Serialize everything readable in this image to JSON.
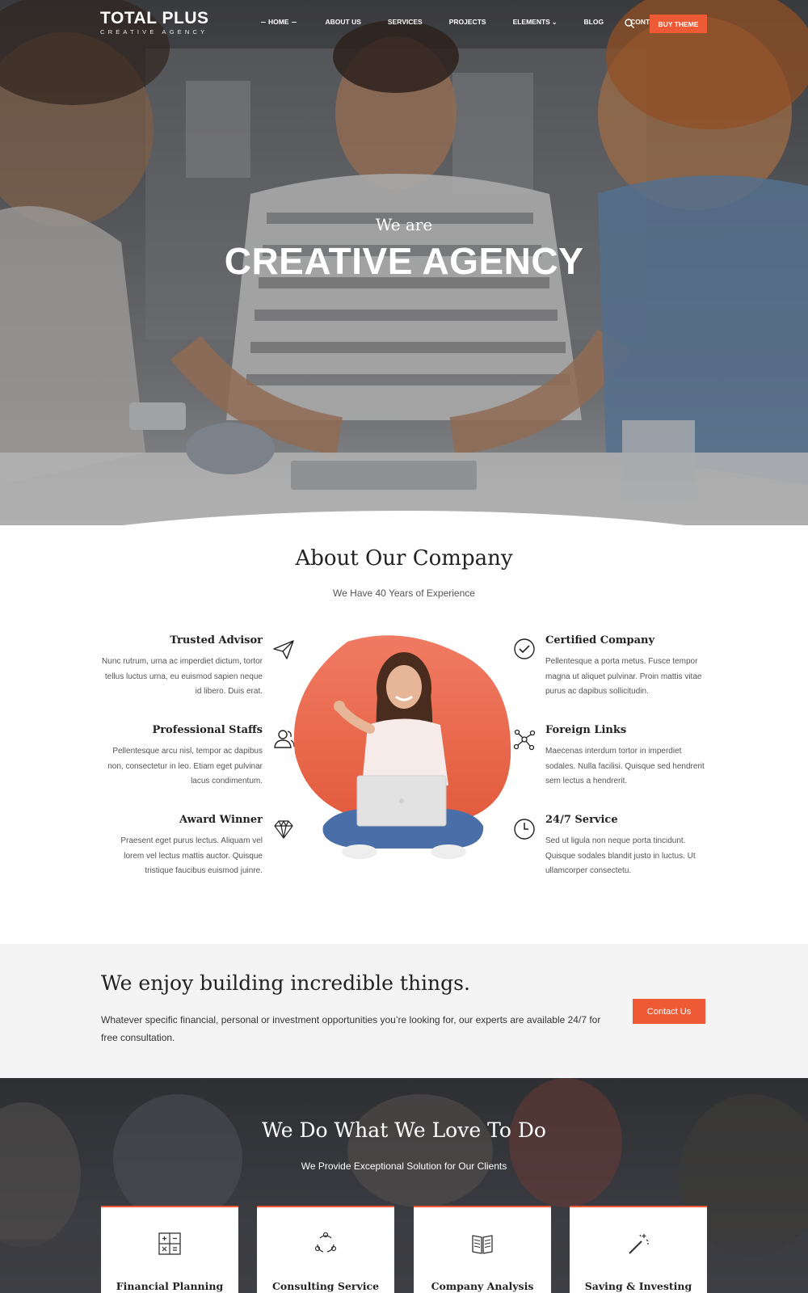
{
  "brand": {
    "name": "TOTAL PLUS",
    "tagline": "CREATIVE AGENCY"
  },
  "nav": {
    "items": [
      {
        "label": "HOME"
      },
      {
        "label": "ABOUT US"
      },
      {
        "label": "SERVICES"
      },
      {
        "label": "PROJECTS"
      },
      {
        "label": "ELEMENTS"
      },
      {
        "label": "BLOG"
      },
      {
        "label": "CONTACT US"
      }
    ],
    "cta_label": "BUY THEME"
  },
  "hero": {
    "pre_title": "We are",
    "title": "CREATIVE AGENCY"
  },
  "about": {
    "title": "About Our Company",
    "subtitle": "We Have 40 Years of Experience",
    "features": [
      {
        "title": "Trusted Advisor",
        "text": "Nunc rutrum, urna ac imperdiet dictum, tortor tellus luctus urna, eu euismod sapien neque id libero. Duis erat.",
        "icon": "paper-plane-icon"
      },
      {
        "title": "Professional Staffs",
        "text": "Pellentesque arcu nisl, tempor ac dapibus non, consectetur in leo. Etiam eget pulvinar lacus condimentum.",
        "icon": "users-icon"
      },
      {
        "title": "Award Winner",
        "text": "Praesent eget purus lectus. Aliquam vel lorem vel lectus mattis auctor. Quisque tristique faucibus euismod juinre.",
        "icon": "diamond-icon"
      },
      {
        "title": "Certified Company",
        "text": "Pellentesque a porta metus. Fusce tempor magna ut aliquet pulvinar. Proin mattis vitae purus ac dapibus sollicitudin.",
        "icon": "check-circle-icon"
      },
      {
        "title": "Foreign Links",
        "text": "Maecenas interdum tortor in imperdiet sodales. Nulla facilisi. Quisque sed hendrerit sem lectus a hendrerit.",
        "icon": "network-icon"
      },
      {
        "title": "24/7 Service",
        "text": "Sed ut ligula non neque porta tincidunt. Quisque sodales blandit justo in luctus. Ut ullamcorper consectetu.",
        "icon": "clock-icon"
      }
    ]
  },
  "cta": {
    "title": "We enjoy building incredible things.",
    "text": "Whatever specific financial, personal or investment opportunities you’re looking for, our experts are available 24/7 for free consultation.",
    "button_label": "Contact Us"
  },
  "services": {
    "title": "We Do What We Love To Do",
    "subtitle": "We Provide Exceptional Solution for Our Clients",
    "cards": [
      {
        "label": "Financial Planning",
        "icon": "calculator-icon"
      },
      {
        "label": "Consulting Service",
        "icon": "cycle-icon"
      },
      {
        "label": "Company Analysis",
        "icon": "book-icon"
      },
      {
        "label": "Saving & Investing",
        "icon": "magic-wand-icon"
      }
    ]
  },
  "colors": {
    "accent": "#ef5a36",
    "light_bg": "#f4f4f4",
    "dark_bg": "#2e2f33"
  }
}
